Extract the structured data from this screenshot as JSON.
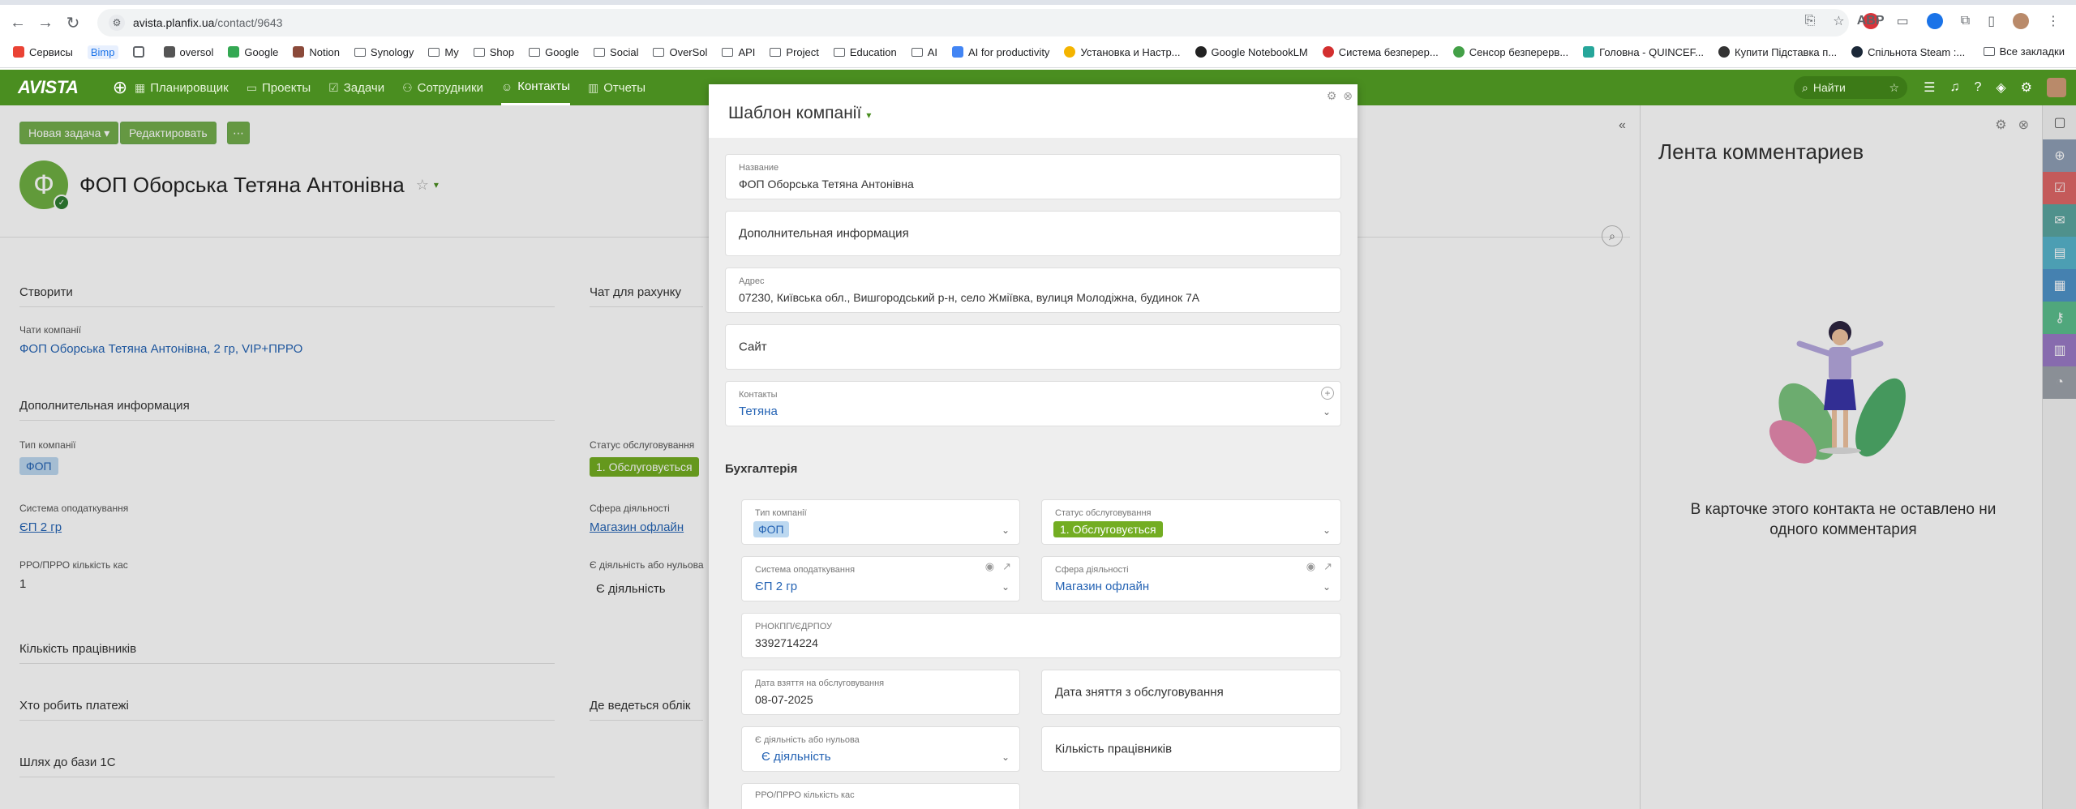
{
  "browser": {
    "url_host": "avista.planfix.ua",
    "url_path": "/contact/9643",
    "bookmarks": [
      "Сервисы",
      "Bimp",
      "oversol",
      "Google",
      "Notion",
      "Synology",
      "My",
      "Shop",
      "Google",
      "Social",
      "OverSol",
      "API",
      "Project",
      "Education",
      "AI",
      "AI for productivity",
      "Установка и Настр...",
      "Google NotebookLM",
      "Система безперер...",
      "Сенсор безперерв...",
      "Головна - QUINCEF...",
      "Купити Підставка п...",
      "Спільнота Steam :..."
    ],
    "bookmarks_all": "Все закладки",
    "ext_abp": "ABP"
  },
  "app": {
    "logo": "AVISTA",
    "menu": [
      {
        "label": "Планировщик",
        "icon": "calendar-icon"
      },
      {
        "label": "Проекты",
        "icon": "folder-icon"
      },
      {
        "label": "Задачи",
        "icon": "check-icon"
      },
      {
        "label": "Сотрудники",
        "icon": "people-icon"
      },
      {
        "label": "Контакты",
        "icon": "contact-icon"
      },
      {
        "label": "Отчеты",
        "icon": "chart-icon"
      }
    ],
    "search_placeholder": "Найти"
  },
  "page": {
    "btn_new_task": "Новая задача ▾",
    "btn_edit": "Редактировать",
    "btn_more": "⋯",
    "avatar_letter": "Ф",
    "contact_name": "ФОП Оборська Тетяна Антонівна",
    "create": "Створити",
    "chat_for_invoice": "Чат для рахунку",
    "company_chats_label": "Чати компанії",
    "company_chats_value": "ФОП Оборська Тетяна Антонівна, 2 гр, VIP+ПРРО",
    "additional_info": "Дополнительная информация",
    "company_type_label": "Тип компанії",
    "company_type_value": "ФОП",
    "service_status_label": "Статус обслуговування",
    "service_status_value": "1. Обслуговується",
    "tax_system_label": "Система оподаткування",
    "tax_system_value": "ЄП 2 гр",
    "activity_label": "Сфера діяльності",
    "activity_value": "Магазин офлайн",
    "rro_label": "РРО/ПРРО кількість кас",
    "rro_value": "1",
    "zero_label": "Є діяльність або нульова",
    "zero_value": "Є діяльність",
    "employees": "Кількість працівників",
    "who_pays": "Хто робить платежі",
    "where_accounting": "Де ведеться облік",
    "path_1c": "Шлях до бази 1С"
  },
  "comments": {
    "title": "Лента комментариев",
    "empty": "В карточке этого контакта не оставлено ни одного комментария"
  },
  "modal": {
    "title": "Шаблон компанії",
    "name_label": "Название",
    "name_value": "ФОП Оборська Тетяна Антонівна",
    "additional": "Дополнительная информация",
    "address_label": "Адрес",
    "address_value": "07230, Київська обл., Вишгородський р-н, село Жміївка, вулиця Молодіжна, будинок 7А",
    "site": "Сайт",
    "contacts_label": "Контакты",
    "contacts_value": "Тетяна",
    "section": "Бухгалтерія",
    "company_type_label": "Тип компанії",
    "company_type_value": "ФОП",
    "status_label": "Статус обслуговування",
    "status_value": "1. Обслуговується",
    "tax_label": "Система оподаткування",
    "tax_value": "ЄП 2 гр",
    "activity_label": "Сфера діяльності",
    "activity_value": "Магазин офлайн",
    "rnokpp_label": "РНОКПП/ЄДРПОУ",
    "rnokpp_value": "3392714224",
    "date_start_label": "Дата взяття на обслуговування",
    "date_start_value": "08-07-2025",
    "date_end": "Дата зняття з обслуговування",
    "zero_label": "Є діяльність або нульова",
    "zero_value": "Є діяльність",
    "employees": "Кількість працівників",
    "rro_label": "РРО/ПРРО кількість кас"
  },
  "colors": {
    "brand_green": "#4a8e20",
    "status_green": "#73ad22",
    "link_blue": "#2463b4"
  }
}
